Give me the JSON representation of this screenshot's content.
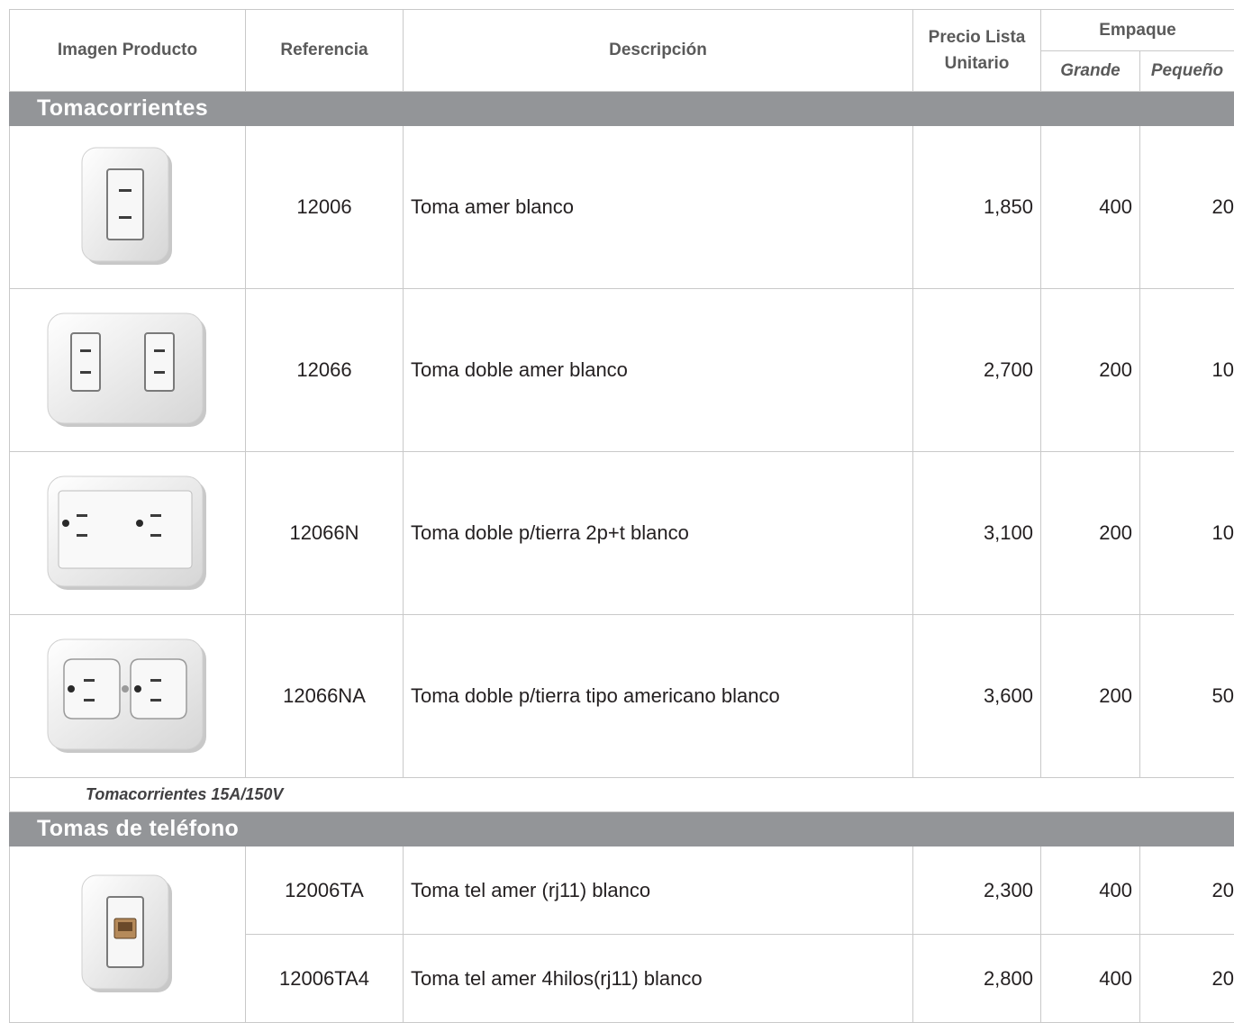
{
  "headers": {
    "image": "Imagen Producto",
    "reference": "Referencia",
    "description": "Descripción",
    "price": "Precio Lista Unitario",
    "packaging": "Empaque",
    "large": "Grande",
    "small": "Pequeño"
  },
  "sections": [
    {
      "title": "Tomacorrientes",
      "rows": [
        {
          "icon": "single-outlet-icon",
          "ref": "12006",
          "desc": "Toma amer blanco",
          "price": "1,850",
          "large": "400",
          "small": "20"
        },
        {
          "icon": "double-outlet-icon",
          "ref": "12066",
          "desc": "Toma doble amer blanco",
          "price": "2,700",
          "large": "200",
          "small": "10"
        },
        {
          "icon": "grounded-double-outlet-icon",
          "ref": "12066N",
          "desc": "Toma doble p/tierra 2p+t blanco",
          "price": "3,100",
          "large": "200",
          "small": "10"
        },
        {
          "icon": "american-double-outlet-icon",
          "ref": "12066NA",
          "desc": "Toma doble p/tierra tipo americano blanco",
          "price": "3,600",
          "large": "200",
          "small": "50"
        }
      ],
      "note": "Tomacorrientes 15A/150V"
    },
    {
      "title": "Tomas de teléfono",
      "rows": [
        {
          "icon": "phone-jack-icon",
          "ref": "12006TA",
          "desc": "Toma tel amer (rj11) blanco",
          "price": "2,300",
          "large": "400",
          "small": "20"
        },
        {
          "ref": "12006TA4",
          "desc": "Toma tel amer 4hilos(rj11) blanco",
          "price": "2,800",
          "large": "400",
          "small": "20"
        }
      ]
    }
  ]
}
